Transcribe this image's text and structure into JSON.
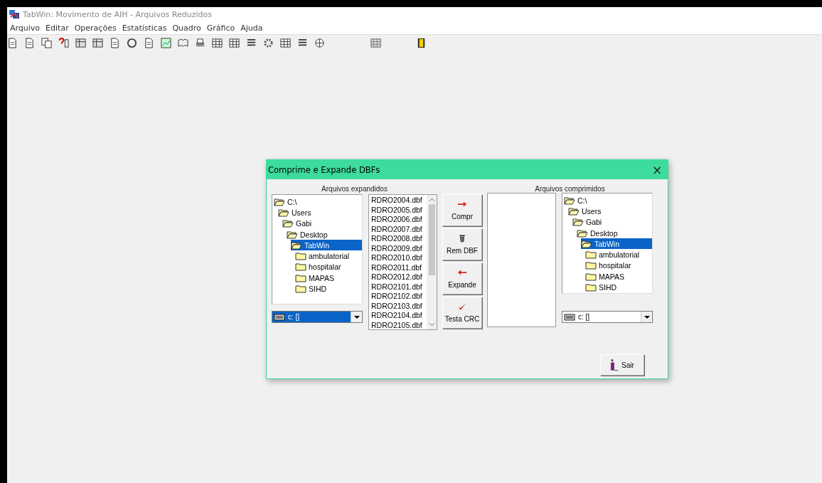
{
  "window": {
    "title": "TabWin: Movimento de AIH - Arquivos Reduzidos"
  },
  "menu": [
    "Arquivo",
    "Editar",
    "Operações",
    "Estatísticas",
    "Quadro",
    "Gráfico",
    "Ajuda"
  ],
  "dialog": {
    "title": "Comprime e Expande DBFs",
    "close": "×",
    "left": {
      "heading": "Arquivos expandidos",
      "tree": [
        {
          "label": "C:\\",
          "expanded": true,
          "selected": false,
          "children": [
            {
              "label": "Users",
              "expanded": true,
              "selected": false,
              "children": [
                {
                  "label": "Gabi",
                  "expanded": true,
                  "selected": false,
                  "children": [
                    {
                      "label": "Desktop",
                      "expanded": true,
                      "selected": false,
                      "children": [
                        {
                          "label": "TabWin",
                          "expanded": true,
                          "selected": true,
                          "children": [
                            {
                              "label": "ambulatorial",
                              "expanded": false,
                              "selected": false
                            },
                            {
                              "label": "hospitalar",
                              "expanded": false,
                              "selected": false
                            },
                            {
                              "label": "MAPAS",
                              "expanded": false,
                              "selected": false
                            },
                            {
                              "label": "SIHD",
                              "expanded": false,
                              "selected": false
                            }
                          ]
                        }
                      ]
                    }
                  ]
                }
              ]
            }
          ]
        }
      ],
      "drive": {
        "value": "c: []",
        "selected": true
      },
      "files": [
        "RDRO2004.dbf",
        "RDRO2005.dbf",
        "RDRO2006.dbf",
        "RDRO2007.dbf",
        "RDRO2008.dbf",
        "RDRO2009.dbf",
        "RDRO2010.dbf",
        "RDRO2011.dbf",
        "RDRO2012.dbf",
        "RDRO2101.dbf",
        "RDRO2102.dbf",
        "RDRO2103.dbf",
        "RDRO2104.dbf",
        "RDRO2105.dbf"
      ]
    },
    "buttons": [
      {
        "kind": "compress",
        "label": "Compr"
      },
      {
        "kind": "remove",
        "label": "Rem DBF"
      },
      {
        "kind": "expand",
        "label": "Expande"
      },
      {
        "kind": "check",
        "label": "Testa CRC"
      }
    ],
    "right": {
      "heading": "Arquivos comprimidos",
      "tree": [
        {
          "label": "C:\\",
          "expanded": true,
          "selected": false,
          "children": [
            {
              "label": "Users",
              "expanded": true,
              "selected": false,
              "children": [
                {
                  "label": "Gabi",
                  "expanded": true,
                  "selected": false,
                  "children": [
                    {
                      "label": "Desktop",
                      "expanded": true,
                      "selected": false,
                      "children": [
                        {
                          "label": "TabWin",
                          "expanded": true,
                          "selected": true,
                          "children": [
                            {
                              "label": "ambulatorial",
                              "expanded": false,
                              "selected": false
                            },
                            {
                              "label": "hospitalar",
                              "expanded": false,
                              "selected": false
                            },
                            {
                              "label": "MAPAS",
                              "expanded": false,
                              "selected": false
                            },
                            {
                              "label": "SIHD",
                              "expanded": false,
                              "selected": false
                            }
                          ]
                        }
                      ]
                    }
                  ]
                }
              ]
            }
          ]
        }
      ],
      "drive": {
        "value": "c: []",
        "selected": false
      }
    },
    "exit": "Sair"
  }
}
